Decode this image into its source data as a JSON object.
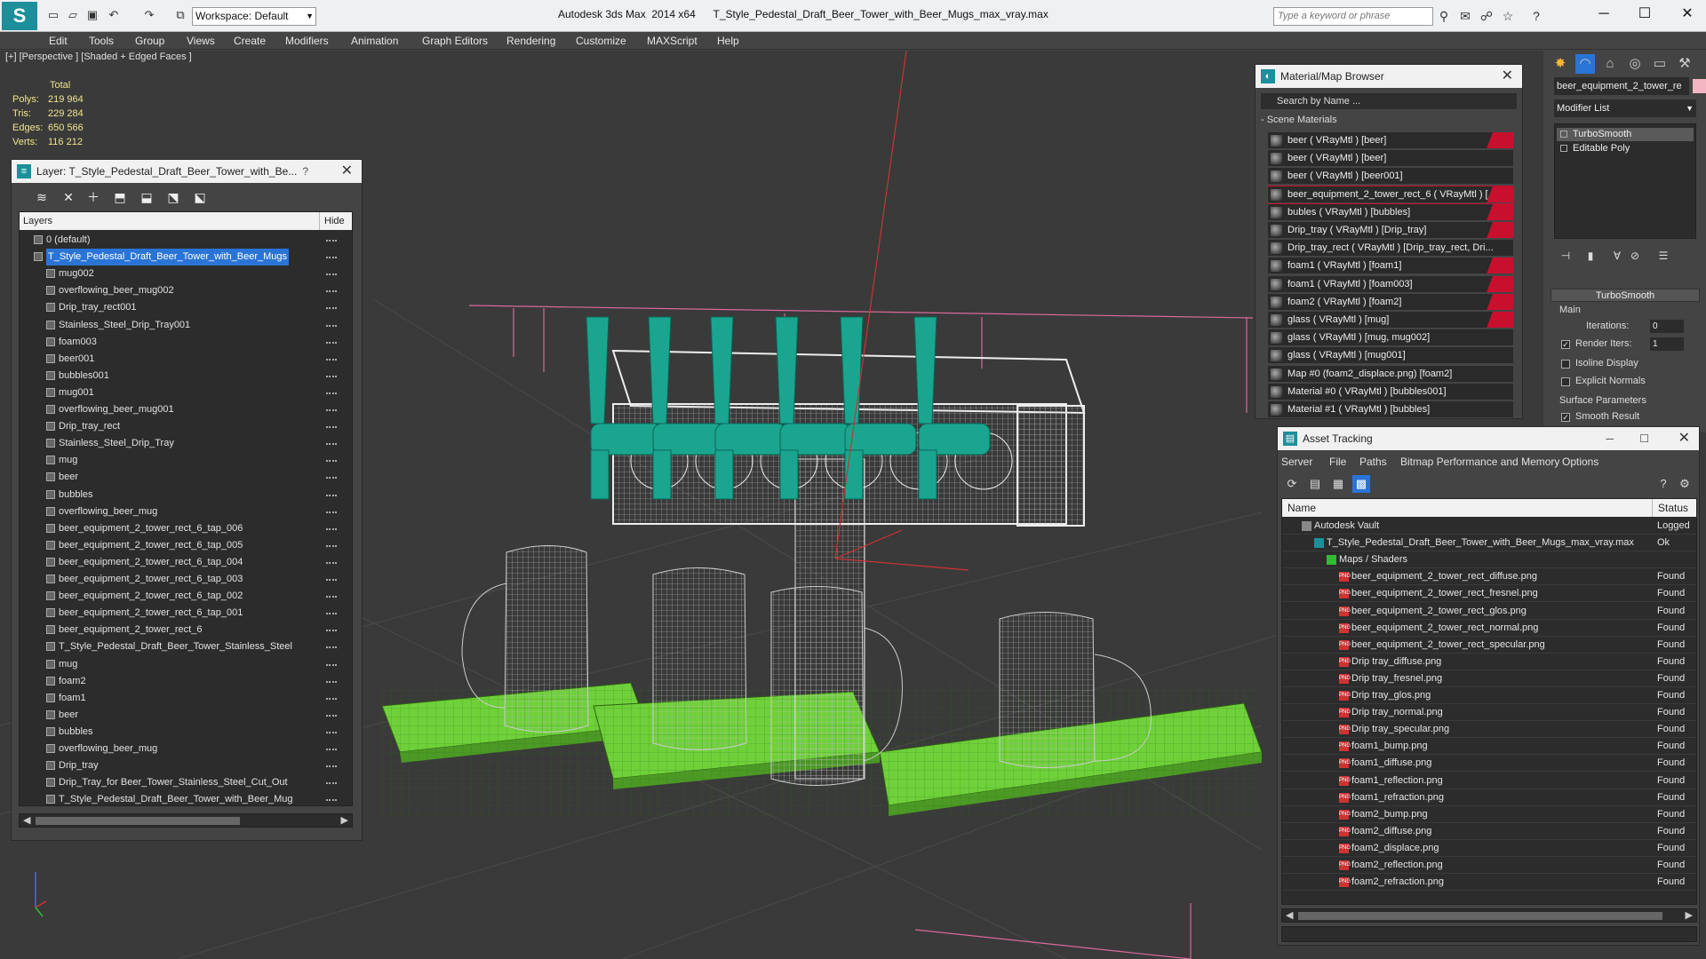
{
  "app": {
    "logo": "S",
    "title": "Autodesk 3ds Max  2014 x64      T_Style_Pedestal_Draft_Beer_Tower_with_Beer_Mugs_max_vray.max",
    "workspace": "Workspace: Default",
    "search_placeholder": "Type a keyword or phrase"
  },
  "menu": [
    "Edit",
    "Tools",
    "Group",
    "Views",
    "Create",
    "Modifiers",
    "Animation",
    "Graph Editors",
    "Rendering",
    "Customize",
    "MAXScript",
    "Help"
  ],
  "viewport": {
    "label": "[+] [Perspective ] [Shaded + Edged Faces ]",
    "stats": {
      "total_label": "Total",
      "rows": [
        {
          "k": "Polys:",
          "v": "219 964"
        },
        {
          "k": "Tris:",
          "v": "229 284"
        },
        {
          "k": "Edges:",
          "v": "650 566"
        },
        {
          "k": "Verts:",
          "v": "116 212"
        }
      ]
    }
  },
  "layer_panel": {
    "title": "Layer: T_Style_Pedestal_Draft_Beer_Tower_with_Be...",
    "help": "?",
    "col_layers": "Layers",
    "col_hide": "Hide",
    "rows": [
      {
        "name": "0 (default)",
        "level": 0
      },
      {
        "name": "T_Style_Pedestal_Draft_Beer_Tower_with_Beer_Mugs",
        "level": 0,
        "selected": true
      },
      {
        "name": "mug002",
        "level": 1
      },
      {
        "name": "overflowing_beer_mug002",
        "level": 1
      },
      {
        "name": "Drip_tray_rect001",
        "level": 1
      },
      {
        "name": "Stainless_Steel_Drip_Tray001",
        "level": 1
      },
      {
        "name": "foam003",
        "level": 1
      },
      {
        "name": "beer001",
        "level": 1
      },
      {
        "name": "bubbles001",
        "level": 1
      },
      {
        "name": "mug001",
        "level": 1
      },
      {
        "name": "overflowing_beer_mug001",
        "level": 1
      },
      {
        "name": "Drip_tray_rect",
        "level": 1
      },
      {
        "name": "Stainless_Steel_Drip_Tray",
        "level": 1
      },
      {
        "name": "mug",
        "level": 1
      },
      {
        "name": "beer",
        "level": 1
      },
      {
        "name": "bubbles",
        "level": 1
      },
      {
        "name": "overflowing_beer_mug",
        "level": 1
      },
      {
        "name": "beer_equipment_2_tower_rect_6_tap_006",
        "level": 1
      },
      {
        "name": "beer_equipment_2_tower_rect_6_tap_005",
        "level": 1
      },
      {
        "name": "beer_equipment_2_tower_rect_6_tap_004",
        "level": 1
      },
      {
        "name": "beer_equipment_2_tower_rect_6_tap_003",
        "level": 1
      },
      {
        "name": "beer_equipment_2_tower_rect_6_tap_002",
        "level": 1
      },
      {
        "name": "beer_equipment_2_tower_rect_6_tap_001",
        "level": 1
      },
      {
        "name": "beer_equipment_2_tower_rect_6",
        "level": 1
      },
      {
        "name": "T_Style_Pedestal_Draft_Beer_Tower_Stainless_Steel",
        "level": 1
      },
      {
        "name": "mug",
        "level": 1
      },
      {
        "name": "foam2",
        "level": 1
      },
      {
        "name": "foam1",
        "level": 1
      },
      {
        "name": "beer",
        "level": 1
      },
      {
        "name": "bubbles",
        "level": 1
      },
      {
        "name": "overflowing_beer_mug",
        "level": 1
      },
      {
        "name": "Drip_tray",
        "level": 1
      },
      {
        "name": "Drip_Tray_for Beer_Tower_Stainless_Steel_Cut_Out",
        "level": 1
      },
      {
        "name": "T_Style_Pedestal_Draft_Beer_Tower_with_Beer_Mug",
        "level": 1
      }
    ]
  },
  "material_browser": {
    "title": "Material/Map Browser",
    "search": "Search by Name ...",
    "section": "- Scene Materials",
    "rows": [
      {
        "name": "beer  ( VRayMtl ) [beer]",
        "red": true
      },
      {
        "name": "beer  ( VRayMtl ) [beer]",
        "red": false
      },
      {
        "name": "beer  ( VRayMtl ) [beer001]",
        "red": false
      },
      {
        "name": "beer_equipment_2_tower_rect_6  ( VRayMtl ) [...",
        "red": true,
        "selected": true
      },
      {
        "name": "bubles  ( VRayMtl ) [bubbles]",
        "red": true
      },
      {
        "name": "Drip_tray  ( VRayMtl ) [Drip_tray]",
        "red": true
      },
      {
        "name": "Drip_tray_rect  ( VRayMtl ) [Drip_tray_rect, Dri...",
        "red": false
      },
      {
        "name": "foam1  ( VRayMtl ) [foam1]",
        "red": true
      },
      {
        "name": "foam1  ( VRayMtl ) [foam003]",
        "red": true
      },
      {
        "name": "foam2  ( VRayMtl ) [foam2]",
        "red": true
      },
      {
        "name": "glass  ( VRayMtl ) [mug]",
        "red": true
      },
      {
        "name": "glass  ( VRayMtl ) [mug, mug002]",
        "red": false
      },
      {
        "name": "glass  ( VRayMtl ) [mug001]",
        "red": false
      },
      {
        "name": "Map #0 (foam2_displace.png) [foam2]",
        "red": false
      },
      {
        "name": "Material #0  ( VRayMtl ) [bubbles001]",
        "red": false
      },
      {
        "name": "Material #1  ( VRayMtl ) [bubbles]",
        "red": false
      }
    ]
  },
  "modifier_panel": {
    "object_name": "beer_equipment_2_tower_re",
    "modifier_list": "Modifier List",
    "stack": [
      {
        "name": "TurboSmooth",
        "selected": true
      },
      {
        "name": "Editable Poly",
        "selected": false
      }
    ],
    "rollout_title": "TurboSmooth",
    "main_label": "Main",
    "iterations_label": "Iterations:",
    "iterations_value": "0",
    "render_iters_label": "Render Iters:",
    "render_iters_value": "1",
    "isoline_label": "Isoline Display",
    "explicit_normals_label": "Explicit Normals",
    "surface_params_label": "Surface Parameters",
    "smooth_result_label": "Smooth Result"
  },
  "asset_tracking": {
    "title": "Asset Tracking",
    "menu": [
      "Server",
      "File",
      "Paths",
      "Bitmap Performance and Memory",
      "Options"
    ],
    "col_name": "Name",
    "col_status": "Status",
    "rows": [
      {
        "name": "Autodesk Vault",
        "status": "Logged",
        "type": "vault",
        "level": 1
      },
      {
        "name": "T_Style_Pedestal_Draft_Beer_Tower_with_Beer_Mugs_max_vray.max",
        "status": "Ok",
        "type": "file",
        "level": 2
      },
      {
        "name": "Maps / Shaders",
        "status": "",
        "type": "fold",
        "level": 3
      },
      {
        "name": "beer_equipment_2_tower_rect_diffuse.png",
        "status": "Found",
        "type": "png",
        "level": 4
      },
      {
        "name": "beer_equipment_2_tower_rect_fresnel.png",
        "status": "Found",
        "type": "png",
        "level": 4
      },
      {
        "name": "beer_equipment_2_tower_rect_glos.png",
        "status": "Found",
        "type": "png",
        "level": 4
      },
      {
        "name": "beer_equipment_2_tower_rect_normal.png",
        "status": "Found",
        "type": "png",
        "level": 4
      },
      {
        "name": "beer_equipment_2_tower_rect_specular.png",
        "status": "Found",
        "type": "png",
        "level": 4
      },
      {
        "name": "Drip tray_diffuse.png",
        "status": "Found",
        "type": "png",
        "level": 4
      },
      {
        "name": "Drip tray_fresnel.png",
        "status": "Found",
        "type": "png",
        "level": 4
      },
      {
        "name": "Drip tray_glos.png",
        "status": "Found",
        "type": "png",
        "level": 4
      },
      {
        "name": "Drip tray_normal.png",
        "status": "Found",
        "type": "png",
        "level": 4
      },
      {
        "name": "Drip tray_specular.png",
        "status": "Found",
        "type": "png",
        "level": 4
      },
      {
        "name": "foam1_bump.png",
        "status": "Found",
        "type": "png",
        "level": 4
      },
      {
        "name": "foam1_diffuse.png",
        "status": "Found",
        "type": "png",
        "level": 4
      },
      {
        "name": "foam1_reflection.png",
        "status": "Found",
        "type": "png",
        "level": 4
      },
      {
        "name": "foam1_refraction.png",
        "status": "Found",
        "type": "png",
        "level": 4
      },
      {
        "name": "foam2_bump.png",
        "status": "Found",
        "type": "png",
        "level": 4
      },
      {
        "name": "foam2_diffuse.png",
        "status": "Found",
        "type": "png",
        "level": 4
      },
      {
        "name": "foam2_displace.png",
        "status": "Found",
        "type": "png",
        "level": 4
      },
      {
        "name": "foam2_reflection.png",
        "status": "Found",
        "type": "png",
        "level": 4
      },
      {
        "name": "foam2_refraction.png",
        "status": "Found",
        "type": "png",
        "level": 4
      }
    ]
  },
  "colors": {
    "accent": "#1c8f9a",
    "selection": "#2a74d6",
    "tray_green": "#6fd13a",
    "tap_teal": "#1aa58f",
    "stats_yellow": "#f0e68c",
    "missing_red": "#c8102e"
  }
}
